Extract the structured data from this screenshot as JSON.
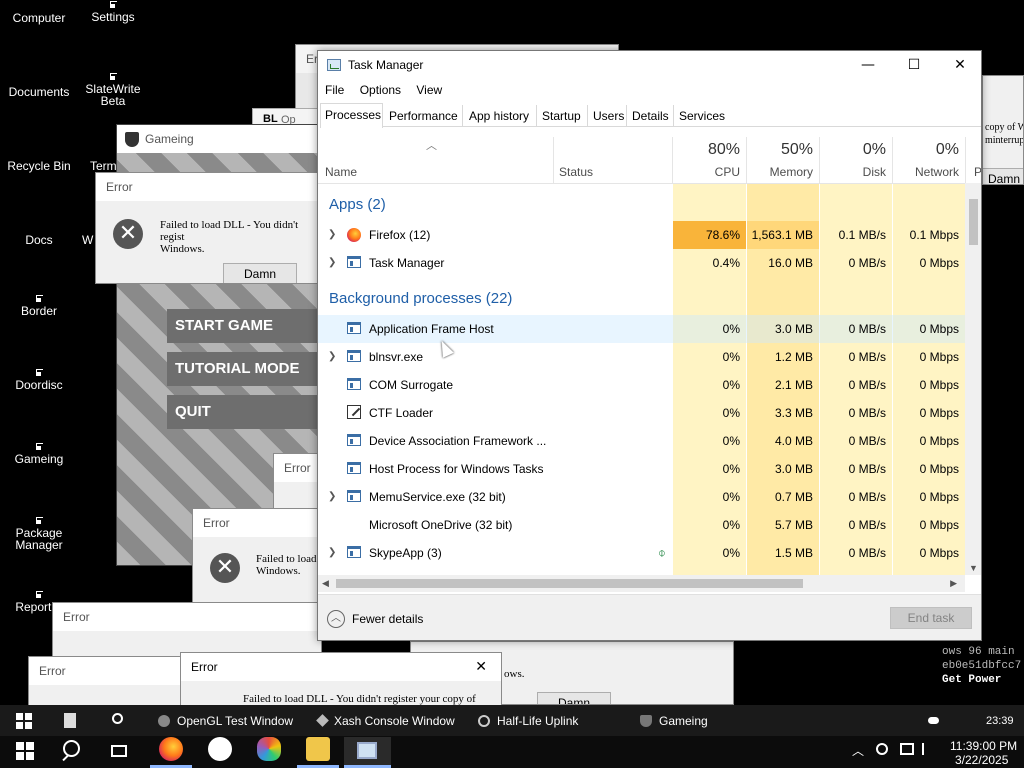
{
  "desktop": {
    "icons": [
      {
        "label": "Computer"
      },
      {
        "label": "Settings"
      },
      {
        "label": "Documents"
      },
      {
        "label": "SlateWrite Beta"
      },
      {
        "label": "Recycle Bin"
      },
      {
        "label": "Term"
      },
      {
        "label": "Docs"
      },
      {
        "label": "W"
      },
      {
        "label": "Border"
      },
      {
        "label": "Doordisc"
      },
      {
        "label": "Gameing"
      },
      {
        "label": "Package Manager"
      },
      {
        "label": "Report B"
      }
    ]
  },
  "game_window": {
    "title": "Gameing",
    "buttons": [
      "START GAME",
      "TUTORIAL MODE",
      "QUIT"
    ]
  },
  "error_dialog": {
    "title": "Error",
    "message": "Failed to load DLL - You didn't register your copy of Windows.",
    "message_short": "Failed to load DLL - You didn't regist",
    "message_line2": "Windows.",
    "message_tiny": "Failed to load",
    "button": "Damn",
    "right_clip_1": "copy of W",
    "right_clip_2": "minterrup",
    "bottom_line1": "Failed to load DLL - You didn't register your copy of",
    "bottom_line2": "ows.",
    "bl_label": "BL",
    "op_label": "Op"
  },
  "task_manager": {
    "title": "Task Manager",
    "menu": [
      "File",
      "Options",
      "View"
    ],
    "tabs": [
      "Processes",
      "Performance",
      "App history",
      "Startup",
      "Users",
      "Details",
      "Services"
    ],
    "columns": {
      "name": "Name",
      "status": "Status",
      "cpu": {
        "pct": "80%",
        "label": "CPU"
      },
      "memory": {
        "pct": "50%",
        "label": "Memory"
      },
      "disk": {
        "pct": "0%",
        "label": "Disk"
      },
      "network": {
        "pct": "0%",
        "label": "Network"
      },
      "power": "P"
    },
    "sections": {
      "apps": "Apps (2)",
      "background": "Background processes (22)"
    },
    "apps": [
      {
        "name": "Firefox (12)",
        "cpu": "78.6%",
        "mem": "1,563.1 MB",
        "disk": "0.1 MB/s",
        "net": "0.1 Mbps"
      },
      {
        "name": "Task Manager",
        "cpu": "0.4%",
        "mem": "16.0 MB",
        "disk": "0 MB/s",
        "net": "0 Mbps"
      }
    ],
    "background": [
      {
        "name": "Application Frame Host",
        "cpu": "0%",
        "mem": "3.0 MB",
        "disk": "0 MB/s",
        "net": "0 Mbps"
      },
      {
        "name": "blnsvr.exe",
        "cpu": "0%",
        "mem": "1.2 MB",
        "disk": "0 MB/s",
        "net": "0 Mbps"
      },
      {
        "name": "COM Surrogate",
        "cpu": "0%",
        "mem": "2.1 MB",
        "disk": "0 MB/s",
        "net": "0 Mbps"
      },
      {
        "name": "CTF Loader",
        "cpu": "0%",
        "mem": "3.3 MB",
        "disk": "0 MB/s",
        "net": "0 Mbps"
      },
      {
        "name": "Device Association Framework ...",
        "cpu": "0%",
        "mem": "4.0 MB",
        "disk": "0 MB/s",
        "net": "0 Mbps"
      },
      {
        "name": "Host Process for Windows Tasks",
        "cpu": "0%",
        "mem": "3.0 MB",
        "disk": "0 MB/s",
        "net": "0 Mbps"
      },
      {
        "name": "MemuService.exe (32 bit)",
        "cpu": "0%",
        "mem": "0.7 MB",
        "disk": "0 MB/s",
        "net": "0 Mbps"
      },
      {
        "name": "Microsoft OneDrive (32 bit)",
        "cpu": "0%",
        "mem": "5.7 MB",
        "disk": "0 MB/s",
        "net": "0 Mbps"
      },
      {
        "name": "SkypeApp (3)",
        "cpu": "0%",
        "mem": "1.5 MB",
        "disk": "0 MB/s",
        "net": "0 Mbps"
      }
    ],
    "footer": {
      "fewer_details": "Fewer details",
      "end_task": "End task"
    }
  },
  "inner_taskbar": {
    "items": [
      "OpenGL Test Window",
      "Xash Console Window",
      "Half-Life Uplink",
      "Gameing"
    ],
    "time": "23:39"
  },
  "console_text": {
    "line1": "ows 96 main",
    "line2": "eb0e51dbfcc7",
    "line3": "Get Power"
  },
  "taskbar": {
    "time": "11:39:00 PM",
    "date": "3/22/2025"
  },
  "colors": {
    "cpu_high": "#f9b43a",
    "cell_light": "#fff4c4",
    "cell_mid": "#ffeaa6",
    "accent_blue": "#1f5fa8"
  }
}
